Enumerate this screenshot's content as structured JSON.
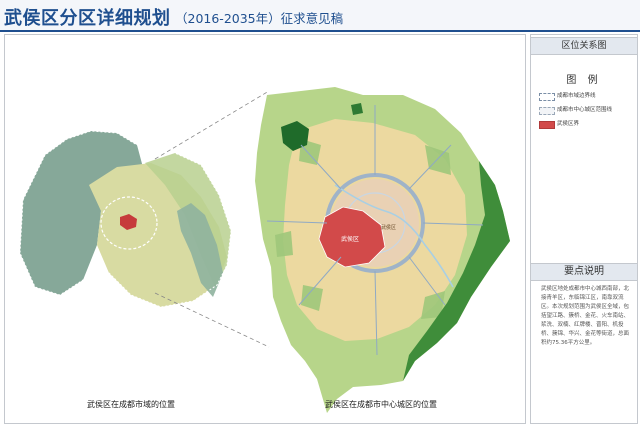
{
  "header": {
    "title": "武侯区分区详细规划",
    "subtitle": "（2016-2035年）征求意见稿"
  },
  "side_panel": {
    "location_heading": "区位关系图",
    "legend_heading": "图  例",
    "legend_items": [
      {
        "swatch": "dashed-white",
        "label": "成都市域边界线"
      },
      {
        "swatch": "dashed-light",
        "label": "成都市中心城区范围线"
      },
      {
        "swatch": "red-fill",
        "label": "武侯区界"
      }
    ],
    "keypoints_heading": "要点说明",
    "keypoints_text": "武侯区地处成都市中心城西南部，北接青羊区，东临锦江区，南靠双流区。本次规划范围为武侯区全域，包括望江路、簇桥、金花、火车南站、浆洗、双楠、红牌楼、晋阳、机投桥、簇锦、华兴、金花等街道，总面积约75.36平方公里。"
  },
  "map": {
    "left_caption": "武侯区在成都市域的位置",
    "right_caption": "武侯区在成都市中心城区的位置",
    "center_label": "武侯区",
    "district_label": "武侯区",
    "colors": {
      "mountain_green": "#6f9f88",
      "plain_green": "#b7d58a",
      "urban_yellow": "#ecd9a0",
      "core_beige": "#e9d1b4",
      "park_green": "#1f6b2a",
      "forest_green": "#3f8d3a",
      "water_blue": "#a8cfe4",
      "district_red": "#d24a4a",
      "frame_blue": "#1f4f8f"
    }
  }
}
